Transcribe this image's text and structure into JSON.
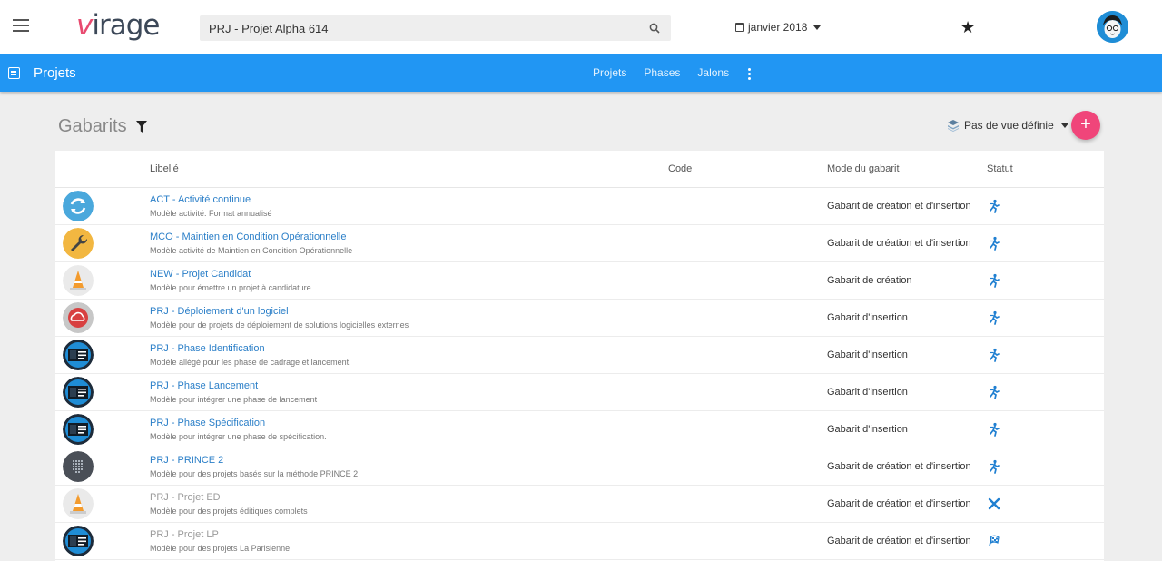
{
  "header": {
    "logo_v": "v",
    "logo_rest": "irage",
    "search_value": "PRJ - Projet Alpha 614",
    "date_label": "janvier 2018"
  },
  "navbar": {
    "title": "Projets",
    "links": [
      "Projets",
      "Phases",
      "Jalons"
    ]
  },
  "page": {
    "title": "Gabarits",
    "view_label": "Pas de vue définie",
    "add_label": "+"
  },
  "table": {
    "columns": {
      "libelle": "Libellé",
      "code": "Code",
      "mode": "Mode du gabarit",
      "statut": "Statut"
    },
    "rows": [
      {
        "title": "ACT - Activité continue",
        "desc": "Modèle activité. Format annualisé",
        "mode": "Gabarit de création et d'insertion",
        "icon": "refresh-icon",
        "status": "active-status-icon",
        "muted": false
      },
      {
        "title": "MCO - Maintien en Condition Opérationnelle",
        "desc": "Modèle activité de Maintien en Condition Opérationnelle",
        "mode": "Gabarit de création et d'insertion",
        "icon": "wrench-icon",
        "status": "active-status-icon",
        "muted": false
      },
      {
        "title": "NEW - Projet Candidat",
        "desc": "Modèle pour émettre un projet à candidature",
        "mode": "Gabarit de création",
        "icon": "traffic-cone-icon",
        "status": "active-status-icon",
        "muted": false
      },
      {
        "title": "PRJ - Déploiement d'un logiciel",
        "desc": "Modèle pour de projets de déploiement de solutions logicielles externes",
        "mode": "Gabarit d'insertion",
        "icon": "cloud-icon",
        "status": "active-status-icon",
        "muted": false
      },
      {
        "title": "PRJ - Phase Identification",
        "desc": "Modèle allégé pour les phase de cadrage et lancement.",
        "mode": "Gabarit d'insertion",
        "icon": "project-card-icon",
        "status": "active-status-icon",
        "muted": false
      },
      {
        "title": "PRJ - Phase Lancement",
        "desc": "Modèle pour intégrer une phase de lancement",
        "mode": "Gabarit d'insertion",
        "icon": "project-card-icon",
        "status": "active-status-icon",
        "muted": false
      },
      {
        "title": "PRJ - Phase Spécification",
        "desc": "Modèle pour intégrer une phase de spécification.",
        "mode": "Gabarit d'insertion",
        "icon": "project-card-icon",
        "status": "active-status-icon",
        "muted": false
      },
      {
        "title": "PRJ - PRINCE 2",
        "desc": "Modèle pour des projets basés sur la méthode PRINCE 2",
        "mode": "Gabarit de création et d'insertion",
        "icon": "dot-grid-icon",
        "status": "active-status-icon",
        "muted": false
      },
      {
        "title": "PRJ - Projet ED",
        "desc": "Modèle pour des projets éditiques complets",
        "mode": "Gabarit de création et d'insertion",
        "icon": "traffic-cone-icon",
        "status": "inactive-status-icon",
        "muted": true
      },
      {
        "title": "PRJ - Projet LP",
        "desc": "Modèle pour des projets La Parisienne",
        "mode": "Gabarit de création et d'insertion",
        "icon": "project-card-icon",
        "status": "finished-status-icon",
        "muted": true
      }
    ]
  },
  "colors": {
    "nav_blue": "#2196f3",
    "link_blue": "#2b7fc8",
    "accent_pink": "#f0457a",
    "logo_pink": "#e84a6f"
  }
}
